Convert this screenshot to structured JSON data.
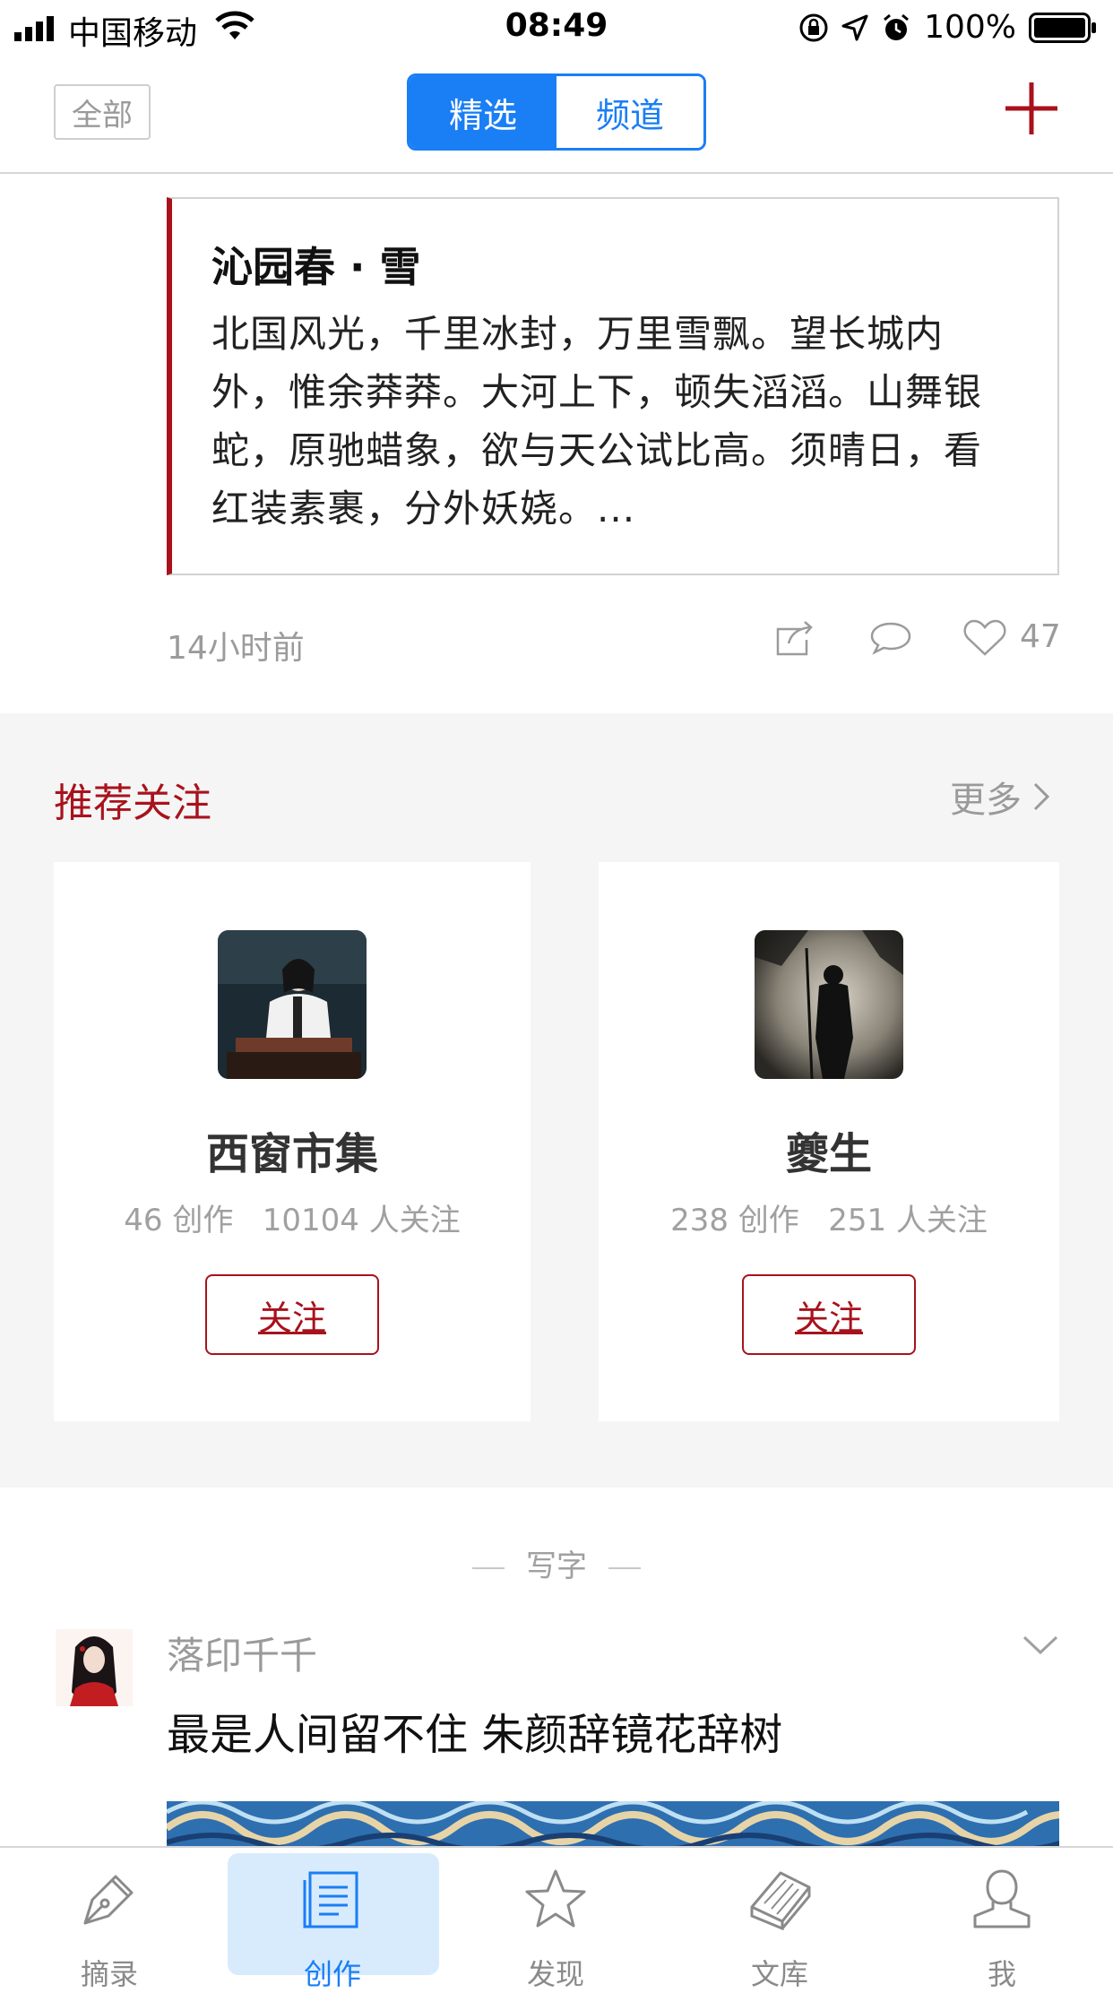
{
  "status_bar": {
    "carrier": "中国移动",
    "time": "08:49",
    "battery": "100%",
    "icons": [
      "signal-icon",
      "wifi-icon",
      "rotation-lock-icon",
      "location-icon",
      "alarm-icon",
      "battery-icon"
    ]
  },
  "nav": {
    "all_label": "全部",
    "segments": {
      "selected": "精选",
      "channel": "频道"
    },
    "add_icon": "plus-icon"
  },
  "poem": {
    "title": "沁园春 · 雪",
    "body": "北国风光，千里冰封，万里雪飘。望长城内外，惟余莽莽。大河上下，顿失滔滔。山舞银蛇，原驰蜡象，欲与天公试比高。须晴日，看红装素裹，分外妖娆。...",
    "time": "14小时前",
    "likes": "47"
  },
  "recommend": {
    "title": "推荐关注",
    "more": "更多",
    "users": [
      {
        "name": "西窗市集",
        "stats": "46 创作   10104 人关注",
        "follow": "关注"
      },
      {
        "name": "夔生",
        "stats": "238 创作   251 人关注",
        "follow": "关注"
      }
    ]
  },
  "feed": {
    "section": "写字",
    "post": {
      "author": "落印千千",
      "text": "最是人间留不住 朱颜辞镜花辞树"
    }
  },
  "tabs": [
    {
      "label": "摘录",
      "icon": "pen-nib-icon"
    },
    {
      "label": "创作",
      "icon": "document-icon"
    },
    {
      "label": "发现",
      "icon": "star-icon"
    },
    {
      "label": "文库",
      "icon": "books-icon"
    },
    {
      "label": "我",
      "icon": "person-icon"
    }
  ],
  "colors": {
    "accent_blue": "#1a7ef5",
    "accent_red": "#a8121c",
    "active_tab_bg": "#d8ebfd"
  }
}
